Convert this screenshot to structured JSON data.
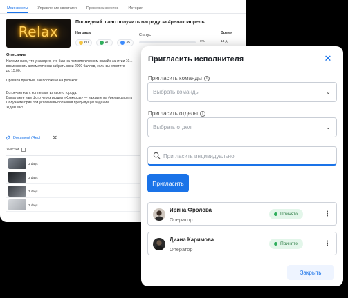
{
  "background_page": {
    "tabs": [
      {
        "label": "Мои квесты"
      },
      {
        "label": "Управление квестами"
      },
      {
        "label": "Проверка квестов"
      },
      {
        "label": "История"
      }
    ],
    "hero_text": "Relax",
    "quest_title": "Последний шанс получить награду за #релаксапрель",
    "reward_label": "Награда",
    "status_label": "Статус",
    "time_label": "Время",
    "rewards": [
      {
        "value": "60",
        "color": "#f5c542"
      },
      {
        "value": "40",
        "color": "#2fae5c"
      },
      {
        "value": "35",
        "color": "#3d8bfd"
      }
    ],
    "progress_text": "0%",
    "progress_fraction": 0,
    "time_value": "14 д.",
    "description_heading": "Описание",
    "description_lines": [
      "Напоминаем, что у каждого, кто был на психологическом онлайн-занятии 10...",
      "возможность автоматически забрать свои 2000 баллов, если вы ответите",
      "до 15:00.",
      "",
      "Правила простые, как положено на релаксе:",
      "",
      "Встречаетесь с коллегами из своего города.",
      "Высылаете нам фото через раздел «Конкурсы» — нажмите на #релаксапрель",
      "Получаете приз при условии выполнения предыдущих заданий!",
      "Ждём вас!"
    ],
    "document_link": "Document (Rec)",
    "works_heading": "Участки",
    "works": [
      {
        "date": "3 days",
        "color": "#59606a"
      },
      {
        "date": "3 days",
        "color": "#2e3136"
      },
      {
        "date": "3 days",
        "color": "#4a4e55"
      },
      {
        "date": "3 days",
        "color": "#b9bcc2"
      }
    ]
  },
  "modal": {
    "title": "Пригласить исполнителя",
    "teams_label": "Пригласить команды",
    "teams_placeholder": "Выбрать команды",
    "departments_label": "Пригласить отделы",
    "departments_placeholder": "Выбрать отдел",
    "search_placeholder": "Пригласить индивидуально",
    "invite_button": "Пригласить",
    "invited": [
      {
        "name": "Ирина Фролова",
        "role": "Оператор",
        "status": "Принято"
      },
      {
        "name": "Диана Каримова",
        "role": "Оператор",
        "status": "Принято"
      }
    ],
    "close_button": "Закрыть"
  },
  "colors": {
    "accent": "#1a73e8",
    "status_accepted_bg": "#e3f6ea",
    "status_accepted_text": "#2e7d46"
  }
}
